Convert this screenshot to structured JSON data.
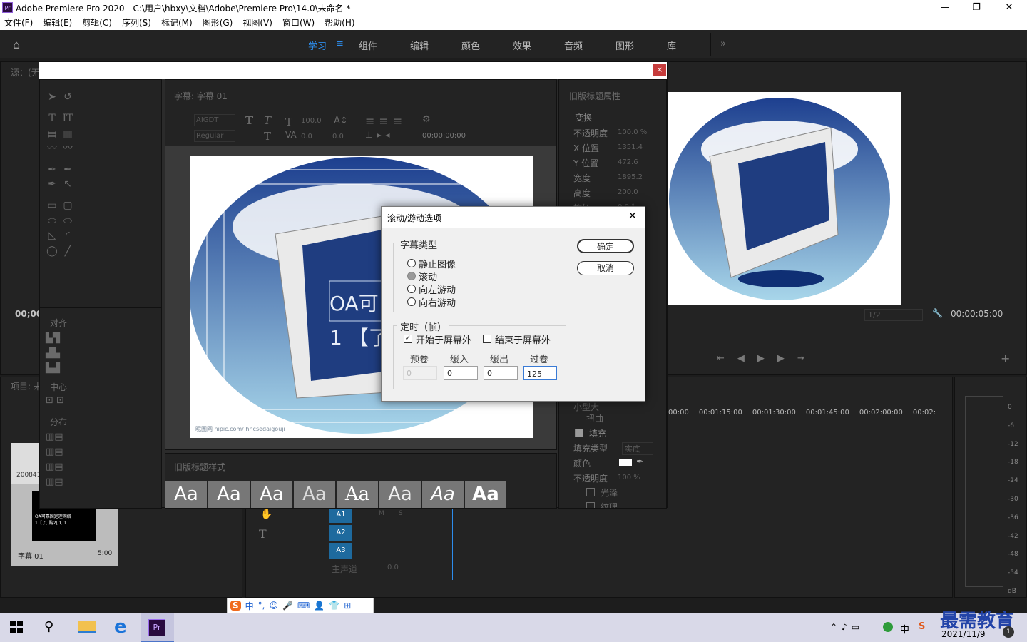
{
  "app": {
    "title": "Adobe Premiere Pro 2020 - C:\\用户\\hbxy\\文档\\Adobe\\Premiere Pro\\14.0\\未命名 *",
    "icon_text": "Pr"
  },
  "window_controls": {
    "minimize": "—",
    "maximize": "❐",
    "close": "✕"
  },
  "menu": [
    "文件(F)",
    "编辑(E)",
    "剪辑(C)",
    "序列(S)",
    "标记(M)",
    "图形(G)",
    "视图(V)",
    "窗口(W)",
    "帮助(H)"
  ],
  "workspaces": {
    "active": "学习",
    "items": [
      "组件",
      "编辑",
      "颜色",
      "效果",
      "音频",
      "图形",
      "库"
    ],
    "more": "»",
    "menu_icon": "≡"
  },
  "source_panel": {
    "label": "源：(无",
    "timecode": "00;00"
  },
  "title_window": {
    "close": "×",
    "title_panel": "字幕: 字幕 01",
    "font": "AIGDT",
    "style": "Regular",
    "size": "100.0",
    "kerning": "0.0",
    "leading": "0.0",
    "tracking": "0.0",
    "timecode": "00:00:00:00",
    "align_label": "对齐",
    "center_label": "中心",
    "distribute_label": "分布",
    "styles_label": "旧版标题样式",
    "style_samples": [
      "Aa",
      "Aa",
      "Aa",
      "Aa",
      "Aa",
      "Aa",
      "Aa",
      "Aa"
    ],
    "canvas_text": [
      "OA可",
      "1 【了"
    ],
    "watermark": "昵图网 nipic.com/ hncsedaigouji"
  },
  "props": {
    "title": "旧版标题属性",
    "transform": "变换",
    "rows": [
      {
        "k": "不透明度",
        "v": "100.0 %"
      },
      {
        "k": "X 位置",
        "v": "1351.4"
      },
      {
        "k": "Y 位置",
        "v": "472.6"
      },
      {
        "k": "宽度",
        "v": "1895.2"
      },
      {
        "k": "高度",
        "v": "200.0"
      },
      {
        "k": "旋转",
        "v": "0.0 °"
      }
    ],
    "distort": "扭曲",
    "fill": "填充",
    "fill_type_label": "填充类型",
    "fill_type": "实底",
    "color": "颜色",
    "opacity2": "不透明度",
    "opacity2_val": "100 %",
    "sheen": "光泽",
    "texture": "纹理",
    "smallcaps": "小型大"
  },
  "scroll_dialog": {
    "title": "滚动/游动选项",
    "close": "✕",
    "type_label": "字幕类型",
    "types": [
      "静止图像",
      "滚动",
      "向左游动",
      "向右游动"
    ],
    "selected": "滚动",
    "timing_label": "定时（帧）",
    "start_off": "开始于屏幕外",
    "end_off": "结束于屏幕外",
    "fields": [
      {
        "label": "预卷",
        "value": "0"
      },
      {
        "label": "缓入",
        "value": "0"
      },
      {
        "label": "缓出",
        "value": "0"
      },
      {
        "label": "过卷",
        "value": "125"
      }
    ],
    "ok": "确定",
    "cancel": "取消"
  },
  "program": {
    "zoom": "1/2",
    "timecode": "00:00:05:00"
  },
  "timeline": {
    "ruler": [
      "00:00",
      "00:01:15:00",
      "00:01:30:00",
      "00:01:45:00",
      "00:02:00:00",
      "00:02:"
    ],
    "tracks": [
      "A1",
      "A2",
      "A3"
    ],
    "master": "主声道",
    "master_val": "0.0",
    "m": "M",
    "s": "S"
  },
  "project": {
    "label": "项目: 未",
    "item1": "200841",
    "item2": "字幕 01",
    "item2_dur": "5:00",
    "thumb_text": "OA可靠固定理网络\n1【了, 购2[D, 1"
  },
  "meter": {
    "scale": [
      "0",
      "-6",
      "-12",
      "-18",
      "-24",
      "-30",
      "-36",
      "-42",
      "-48",
      "-54",
      "dB"
    ]
  },
  "ime": {
    "items": [
      "中",
      "°,",
      "☺",
      "🎤",
      "⌨",
      "👤",
      "👕",
      "⊞"
    ]
  },
  "taskbar": {
    "date": "2021/11/9",
    "ime": "中",
    "brand": "最需教育",
    "notif": "1"
  }
}
